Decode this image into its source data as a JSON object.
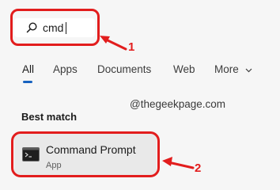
{
  "search": {
    "value": "cmd",
    "icon": "search-icon"
  },
  "tabs": [
    {
      "label": "All",
      "active": true
    },
    {
      "label": "Apps",
      "active": false
    },
    {
      "label": "Documents",
      "active": false
    },
    {
      "label": "Web",
      "active": false
    },
    {
      "label": "More",
      "active": false
    }
  ],
  "more_icon": "chevron-down-icon",
  "watermark": "@thegeekpage.com",
  "best_match": {
    "heading": "Best match",
    "result": {
      "title": "Command Prompt",
      "subtitle": "App",
      "icon": "command-prompt-icon"
    }
  },
  "annotations": {
    "step1": "1",
    "step2": "2",
    "color": "#e21d1d"
  },
  "colors": {
    "accent": "#1862bf",
    "background": "#f6f6f6",
    "highlight": "#e21d1d"
  }
}
